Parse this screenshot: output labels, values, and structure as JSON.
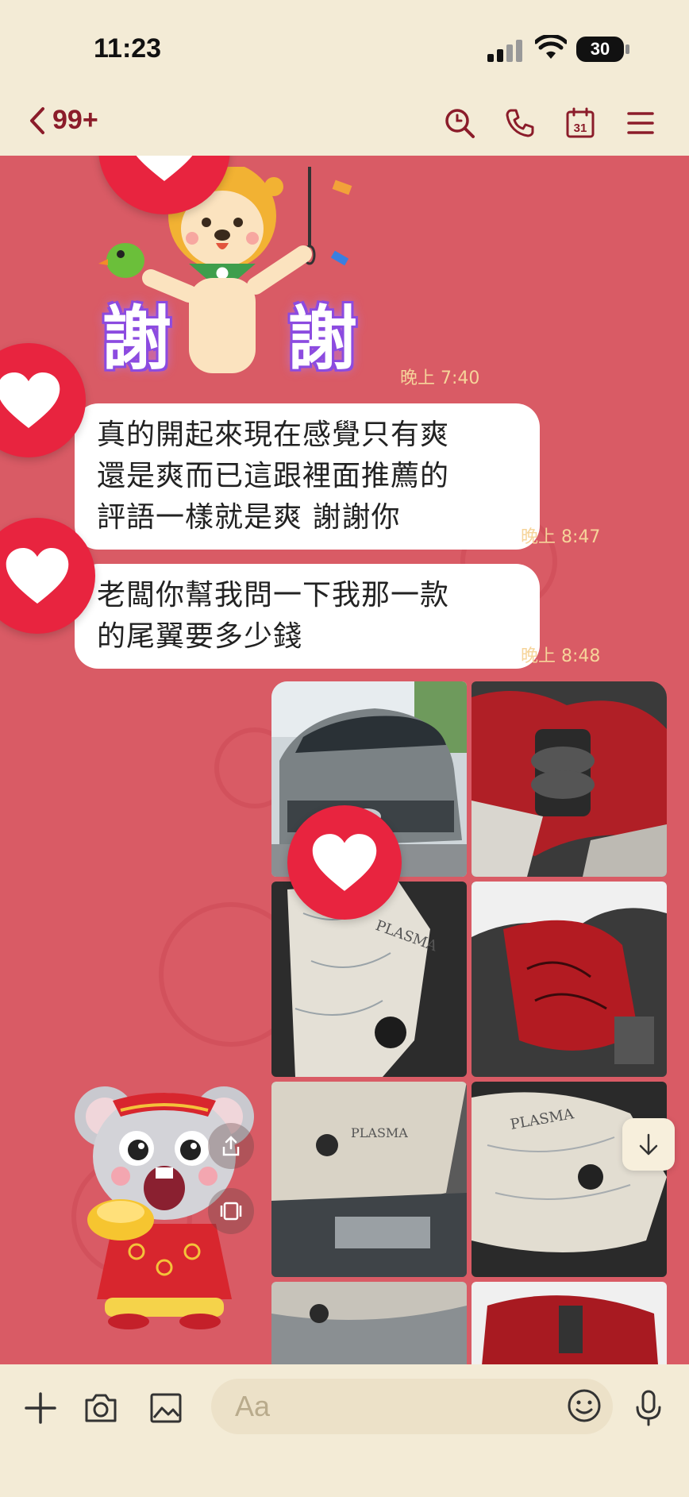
{
  "status_bar": {
    "time": "11:23",
    "battery": "30"
  },
  "nav": {
    "back_count": "99+"
  },
  "messages": [
    {
      "type": "sticker",
      "text_left": "謝",
      "text_right": "謝",
      "time": "晚上 7:40"
    },
    {
      "type": "text",
      "text": "真的開起來現在感覺只有爽\n還是爽而已這跟裡面推薦的\n評語一樣就是爽  謝謝你",
      "time": "晚上 8:47"
    },
    {
      "type": "text",
      "text": "老闆你幫我問一下我那一款\n的尾翼要多少錢",
      "time": "晚上 8:48"
    }
  ],
  "photo_tile_labels": [
    "PLASMA",
    "PLASMA",
    "PLASMA"
  ],
  "input": {
    "placeholder": "Aa"
  },
  "colors": {
    "chat_bg": "#d95b65",
    "bar_bg": "#f3ebd6",
    "heart": "#e8243f",
    "accent": "#8b1c2a"
  }
}
